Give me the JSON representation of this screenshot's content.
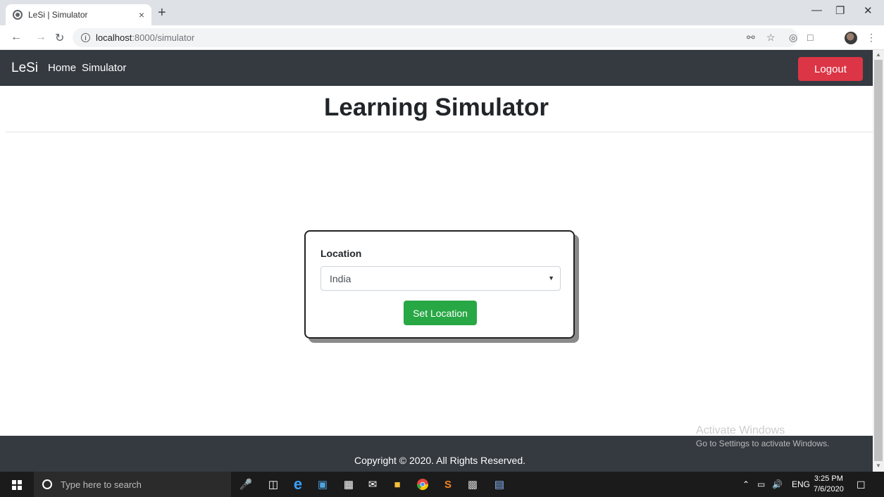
{
  "browser": {
    "tab_title": "LeSi | Simulator",
    "tab_close": "×",
    "new_tab": "+",
    "url_host": "localhost",
    "url_path": ":8000/simulator",
    "info_icon": "i"
  },
  "navbar": {
    "brand": "LeSi",
    "links": [
      "Home",
      "Simulator"
    ],
    "logout": "Logout"
  },
  "page": {
    "heading": "Learning Simulator"
  },
  "form": {
    "label": "Location",
    "selected": "India",
    "button": "Set Location"
  },
  "footer": {
    "copyright": "Copyright © 2020. All Rights Reserved."
  },
  "watermark": {
    "line1": "Activate Windows",
    "line2": "Go to Settings to activate Windows."
  },
  "taskbar": {
    "search_placeholder": "Type here to search",
    "lang": "ENG",
    "time": "3:25 PM",
    "date": "7/6/2020"
  },
  "colors": {
    "navbar": "#343a40",
    "logout": "#dc3545",
    "submit": "#28a745"
  }
}
